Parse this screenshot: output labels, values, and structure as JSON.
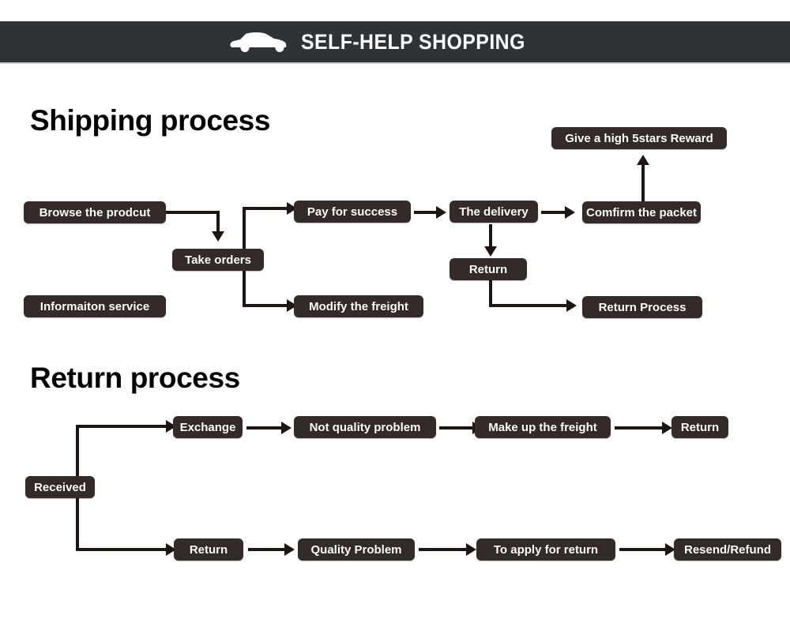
{
  "banner": {
    "title": "SELF-HELP SHOPPING",
    "icon": "car-icon",
    "background_color": "#2e3337"
  },
  "theme": {
    "node_background": "#332b27",
    "node_text": "#ffffff",
    "connector_color": "#1d1612",
    "page_background": "#ffffff"
  },
  "sections": [
    {
      "title": "Shipping process",
      "nodes": [
        {
          "id": "browse",
          "label": "Browse the prodcut"
        },
        {
          "id": "info",
          "label": "Informaiton service"
        },
        {
          "id": "take",
          "label": "Take orders"
        },
        {
          "id": "pay",
          "label": "Pay for success"
        },
        {
          "id": "modify",
          "label": "Modify the freight"
        },
        {
          "id": "delivery",
          "label": "The delivery"
        },
        {
          "id": "confirm",
          "label": "Comfirm the packet"
        },
        {
          "id": "reward",
          "label": "Give a high 5stars Reward"
        },
        {
          "id": "return1",
          "label": "Return"
        },
        {
          "id": "rproc",
          "label": "Return Process"
        }
      ]
    },
    {
      "title": "Return process",
      "nodes": [
        {
          "id": "received",
          "label": "Received"
        },
        {
          "id": "exchange",
          "label": "Exchange"
        },
        {
          "id": "notqual",
          "label": "Not quality problem"
        },
        {
          "id": "makeup",
          "label": "Make up the freight"
        },
        {
          "id": "return_a",
          "label": "Return"
        },
        {
          "id": "return_b",
          "label": "Return"
        },
        {
          "id": "quality",
          "label": "Quality Problem"
        },
        {
          "id": "apply",
          "label": "To apply for return"
        },
        {
          "id": "resend",
          "label": "Resend/Refund"
        }
      ]
    }
  ]
}
